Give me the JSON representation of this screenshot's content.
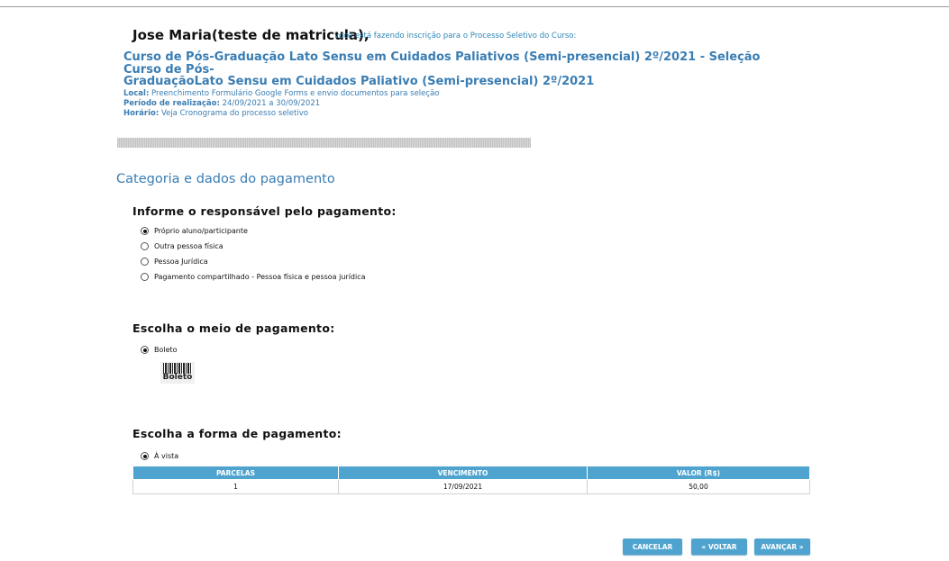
{
  "header": {
    "user_name": "Jose Maria(teste de matricula),",
    "intro": "você está fazendo inscrição para o Processo Seletivo do Curso:",
    "course_line1": "Curso de Pós-Graduação Lato Sensu em Cuidados Paliativos (Semi-presencial) 2º/2021 - Seleção Curso de Pós-",
    "course_line2": "GraduaçãoLato Sensu em Cuidados Paliativo (Semi-presencial) 2º/2021",
    "local_label": "Local:",
    "local_value": "Preenchimento Formulário Google Forms e envio documentos para seleção",
    "period_label": "Período de realização:",
    "period_value": "24/09/2021 a 30/09/2021",
    "time_label": "Horário:",
    "time_value": "Veja Cronograma do processo seletivo"
  },
  "section_title": "Categoria e dados do pagamento",
  "responsavel": {
    "heading": "Informe o responsável pelo pagamento:",
    "options": [
      {
        "label": "Próprio aluno/participante",
        "selected": true
      },
      {
        "label": "Outra pessoa física",
        "selected": false
      },
      {
        "label": "Pessoa Jurídica",
        "selected": false
      },
      {
        "label": "Pagamento compartilhado - Pessoa física e pessoa jurídica",
        "selected": false
      }
    ]
  },
  "meio": {
    "heading": "Escolha o meio de pagamento:",
    "option": "Boleto",
    "icon_text": "Boleto",
    "icon": "barcode-icon"
  },
  "forma": {
    "heading": "Escolha a forma de pagamento:",
    "option": "À vista",
    "table": {
      "headers": [
        "PARCELAS",
        "VENCIMENTO",
        "VALOR (R$)"
      ],
      "rows": [
        [
          "1",
          "17/09/2021",
          "50,00"
        ]
      ]
    }
  },
  "buttons": {
    "cancel": "CANCELAR",
    "back": "« VOLTAR",
    "next": "AVANÇAR »"
  },
  "colors": {
    "accent": "#3a7db3",
    "button": "#4fa4cf"
  }
}
